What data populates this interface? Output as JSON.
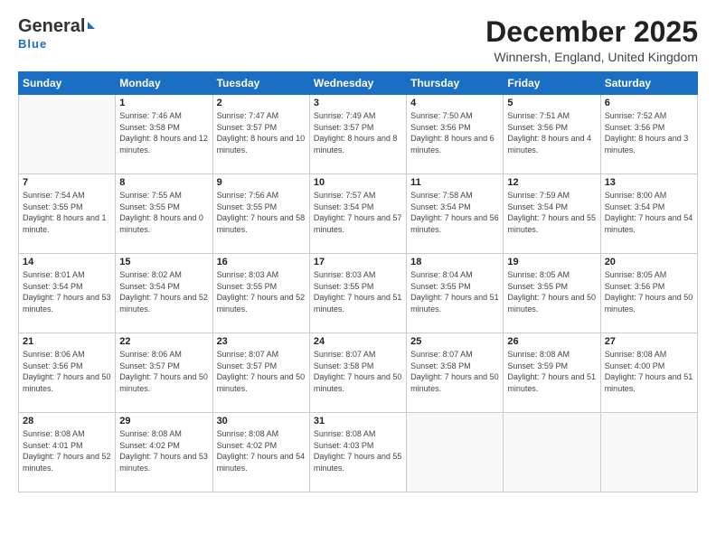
{
  "header": {
    "logo_general": "General",
    "logo_blue": "Blue",
    "month_title": "December 2025",
    "location": "Winnersh, England, United Kingdom"
  },
  "weekdays": [
    "Sunday",
    "Monday",
    "Tuesday",
    "Wednesday",
    "Thursday",
    "Friday",
    "Saturday"
  ],
  "weeks": [
    [
      {
        "day": "",
        "info": ""
      },
      {
        "day": "1",
        "info": "Sunrise: 7:46 AM\nSunset: 3:58 PM\nDaylight: 8 hours\nand 12 minutes."
      },
      {
        "day": "2",
        "info": "Sunrise: 7:47 AM\nSunset: 3:57 PM\nDaylight: 8 hours\nand 10 minutes."
      },
      {
        "day": "3",
        "info": "Sunrise: 7:49 AM\nSunset: 3:57 PM\nDaylight: 8 hours\nand 8 minutes."
      },
      {
        "day": "4",
        "info": "Sunrise: 7:50 AM\nSunset: 3:56 PM\nDaylight: 8 hours\nand 6 minutes."
      },
      {
        "day": "5",
        "info": "Sunrise: 7:51 AM\nSunset: 3:56 PM\nDaylight: 8 hours\nand 4 minutes."
      },
      {
        "day": "6",
        "info": "Sunrise: 7:52 AM\nSunset: 3:56 PM\nDaylight: 8 hours\nand 3 minutes."
      }
    ],
    [
      {
        "day": "7",
        "info": "Sunrise: 7:54 AM\nSunset: 3:55 PM\nDaylight: 8 hours\nand 1 minute."
      },
      {
        "day": "8",
        "info": "Sunrise: 7:55 AM\nSunset: 3:55 PM\nDaylight: 8 hours\nand 0 minutes."
      },
      {
        "day": "9",
        "info": "Sunrise: 7:56 AM\nSunset: 3:55 PM\nDaylight: 7 hours\nand 58 minutes."
      },
      {
        "day": "10",
        "info": "Sunrise: 7:57 AM\nSunset: 3:54 PM\nDaylight: 7 hours\nand 57 minutes."
      },
      {
        "day": "11",
        "info": "Sunrise: 7:58 AM\nSunset: 3:54 PM\nDaylight: 7 hours\nand 56 minutes."
      },
      {
        "day": "12",
        "info": "Sunrise: 7:59 AM\nSunset: 3:54 PM\nDaylight: 7 hours\nand 55 minutes."
      },
      {
        "day": "13",
        "info": "Sunrise: 8:00 AM\nSunset: 3:54 PM\nDaylight: 7 hours\nand 54 minutes."
      }
    ],
    [
      {
        "day": "14",
        "info": "Sunrise: 8:01 AM\nSunset: 3:54 PM\nDaylight: 7 hours\nand 53 minutes."
      },
      {
        "day": "15",
        "info": "Sunrise: 8:02 AM\nSunset: 3:54 PM\nDaylight: 7 hours\nand 52 minutes."
      },
      {
        "day": "16",
        "info": "Sunrise: 8:03 AM\nSunset: 3:55 PM\nDaylight: 7 hours\nand 52 minutes."
      },
      {
        "day": "17",
        "info": "Sunrise: 8:03 AM\nSunset: 3:55 PM\nDaylight: 7 hours\nand 51 minutes."
      },
      {
        "day": "18",
        "info": "Sunrise: 8:04 AM\nSunset: 3:55 PM\nDaylight: 7 hours\nand 51 minutes."
      },
      {
        "day": "19",
        "info": "Sunrise: 8:05 AM\nSunset: 3:55 PM\nDaylight: 7 hours\nand 50 minutes."
      },
      {
        "day": "20",
        "info": "Sunrise: 8:05 AM\nSunset: 3:56 PM\nDaylight: 7 hours\nand 50 minutes."
      }
    ],
    [
      {
        "day": "21",
        "info": "Sunrise: 8:06 AM\nSunset: 3:56 PM\nDaylight: 7 hours\nand 50 minutes."
      },
      {
        "day": "22",
        "info": "Sunrise: 8:06 AM\nSunset: 3:57 PM\nDaylight: 7 hours\nand 50 minutes."
      },
      {
        "day": "23",
        "info": "Sunrise: 8:07 AM\nSunset: 3:57 PM\nDaylight: 7 hours\nand 50 minutes."
      },
      {
        "day": "24",
        "info": "Sunrise: 8:07 AM\nSunset: 3:58 PM\nDaylight: 7 hours\nand 50 minutes."
      },
      {
        "day": "25",
        "info": "Sunrise: 8:07 AM\nSunset: 3:58 PM\nDaylight: 7 hours\nand 50 minutes."
      },
      {
        "day": "26",
        "info": "Sunrise: 8:08 AM\nSunset: 3:59 PM\nDaylight: 7 hours\nand 51 minutes."
      },
      {
        "day": "27",
        "info": "Sunrise: 8:08 AM\nSunset: 4:00 PM\nDaylight: 7 hours\nand 51 minutes."
      }
    ],
    [
      {
        "day": "28",
        "info": "Sunrise: 8:08 AM\nSunset: 4:01 PM\nDaylight: 7 hours\nand 52 minutes."
      },
      {
        "day": "29",
        "info": "Sunrise: 8:08 AM\nSunset: 4:02 PM\nDaylight: 7 hours\nand 53 minutes."
      },
      {
        "day": "30",
        "info": "Sunrise: 8:08 AM\nSunset: 4:02 PM\nDaylight: 7 hours\nand 54 minutes."
      },
      {
        "day": "31",
        "info": "Sunrise: 8:08 AM\nSunset: 4:03 PM\nDaylight: 7 hours\nand 55 minutes."
      },
      {
        "day": "",
        "info": ""
      },
      {
        "day": "",
        "info": ""
      },
      {
        "day": "",
        "info": ""
      }
    ]
  ]
}
